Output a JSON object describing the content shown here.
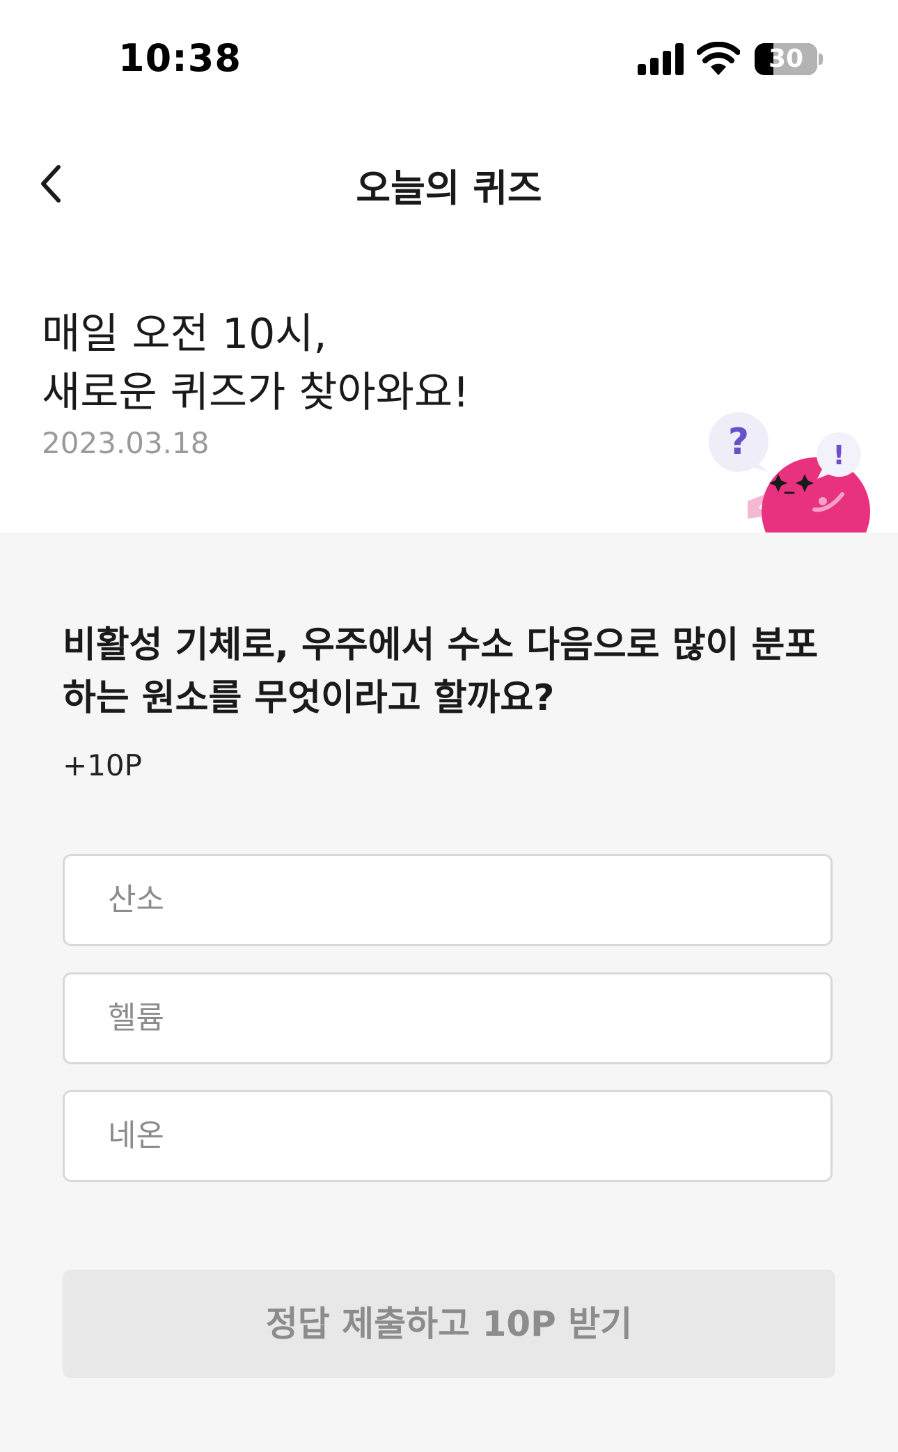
{
  "status_bar": {
    "time": "10:38",
    "battery_level": "30",
    "battery_fraction": 0.3,
    "icons": [
      "signal-icon",
      "wifi-icon",
      "battery-icon"
    ]
  },
  "nav": {
    "title": "오늘의 퀴즈",
    "back_icon": "chevron-left-icon"
  },
  "header": {
    "title": "매일 오전 10시,\n새로운 퀴즈가 찾아와요!",
    "date": "2023.03.18",
    "mascot": {
      "question_mark": "?",
      "exclamation_mark": "!"
    }
  },
  "quiz": {
    "question": "비활성 기체로, 우주에서 수소 다음으로 많이 분포\n하는 원소를 무엇이라고 할까요?",
    "points": "+10P",
    "options": [
      {
        "label": "산소"
      },
      {
        "label": "헬륨"
      },
      {
        "label": "네온"
      }
    ],
    "submit_label": "정답 제출하고 10P 받기"
  },
  "colors": {
    "background": "#ffffff",
    "section_background": "#f6f6f6",
    "mascot_pink": "#e8317f",
    "bubble_purple": "#6a4fc8",
    "disabled_button": "#e8e8e8",
    "disabled_text": "#8c8c8c",
    "date_text": "#9a9a9a"
  }
}
